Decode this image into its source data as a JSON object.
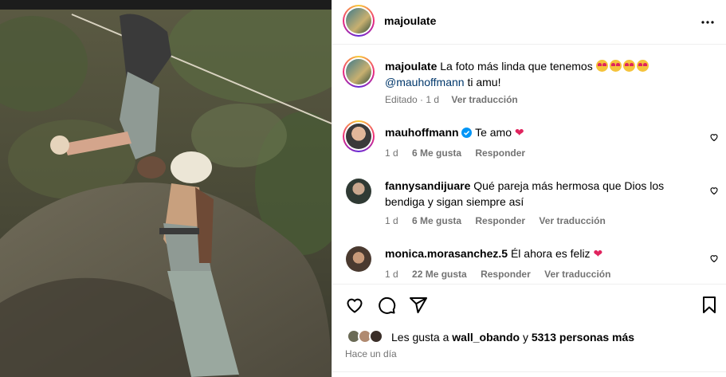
{
  "post": {
    "author": "majoulate",
    "more_icon": "more-horizontal-icon"
  },
  "caption": {
    "username": "majoulate",
    "text": "La foto más linda que tenemos",
    "emojis": [
      "heart-eyes-emoji",
      "heart-eyes-emoji",
      "heart-eyes-emoji",
      "heart-eyes-emoji"
    ],
    "mention": "@mauhoffmann",
    "text2": "ti amu!",
    "edited": "Editado · 1 d",
    "translate": "Ver traducción"
  },
  "comments": [
    {
      "username": "mauhoffmann",
      "verified": true,
      "text": "Te amo",
      "time": "1 d",
      "likes": "6 Me gusta",
      "reply": "Responder"
    },
    {
      "username": "fannysandijuare",
      "text": "Qué pareja más hermosa que Dios los",
      "text2": "bendiga y sigan siempre así",
      "time": "1 d",
      "likes": "6 Me gusta",
      "reply": "Responder",
      "translate": "Ver traducción"
    },
    {
      "username": "monica.morasanchez.5",
      "text": "Él ahora es feliz",
      "time": "1 d",
      "likes": "22 Me gusta",
      "reply": "Responder",
      "translate": "Ver traducción"
    }
  ],
  "likes_line": {
    "prefix": "Les gusta a",
    "user": "wall_obando",
    "middle": "y",
    "others": "5313 personas más"
  },
  "timestamp": "Hace un día",
  "colors": {
    "verified": "#0095f6",
    "heart_red": "#e0245e",
    "muted": "#737373",
    "link": "#00376b"
  }
}
